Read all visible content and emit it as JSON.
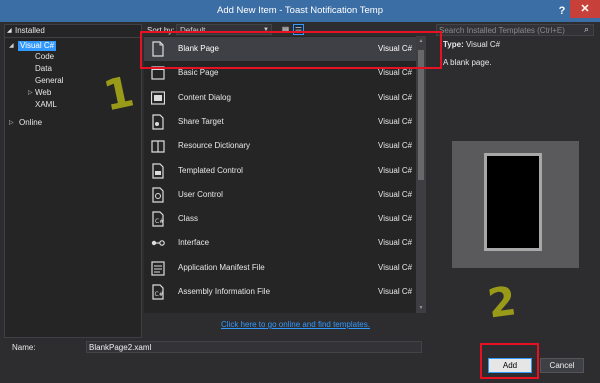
{
  "window": {
    "title": "Add New Item - Toast Notification Temp",
    "help_glyph": "?",
    "close_glyph": "✕"
  },
  "left": {
    "header": "Installed",
    "tree": [
      {
        "label": "Visual C#",
        "selected": true
      },
      {
        "label": "Code"
      },
      {
        "label": "Data"
      },
      {
        "label": "General"
      },
      {
        "label": "Web"
      },
      {
        "label": "XAML"
      },
      {
        "label": "Online"
      }
    ]
  },
  "toolbar": {
    "sort_label": "Sort by:",
    "sort_value": "Default"
  },
  "search": {
    "placeholder": "Search Installed Templates (Ctrl+E)"
  },
  "items": [
    {
      "name": "Blank Page",
      "lang": "Visual C#",
      "icon": "blank-page-icon",
      "selected": true
    },
    {
      "name": "Basic Page",
      "lang": "Visual C#",
      "icon": "basic-page-icon"
    },
    {
      "name": "Content Dialog",
      "lang": "Visual C#",
      "icon": "content-dialog-icon"
    },
    {
      "name": "Share Target",
      "lang": "Visual C#",
      "icon": "share-target-icon"
    },
    {
      "name": "Resource Dictionary",
      "lang": "Visual C#",
      "icon": "resource-dictionary-icon"
    },
    {
      "name": "Templated Control",
      "lang": "Visual C#",
      "icon": "templated-control-icon"
    },
    {
      "name": "User Control",
      "lang": "Visual C#",
      "icon": "user-control-icon"
    },
    {
      "name": "Class",
      "lang": "Visual C#",
      "icon": "class-icon"
    },
    {
      "name": "Interface",
      "lang": "Visual C#",
      "icon": "interface-icon"
    },
    {
      "name": "Application Manifest File",
      "lang": "Visual C#",
      "icon": "manifest-icon"
    },
    {
      "name": "Assembly Information File",
      "lang": "Visual C#",
      "icon": "assembly-info-icon"
    }
  ],
  "online_link": "Click here to go online and find templates.",
  "details": {
    "type_label": "Type:",
    "type_value": "Visual C#",
    "description": "A blank page."
  },
  "name_field": {
    "label": "Name:",
    "value": "BlankPage2.xaml"
  },
  "buttons": {
    "add": "Add",
    "cancel": "Cancel"
  },
  "annotations": {
    "one": "1",
    "two": "2"
  },
  "colors": {
    "accent": "#3399ff",
    "highlight": "#e81123",
    "titlebar": "#3a6ea5",
    "annotation": "#9a9a19"
  }
}
